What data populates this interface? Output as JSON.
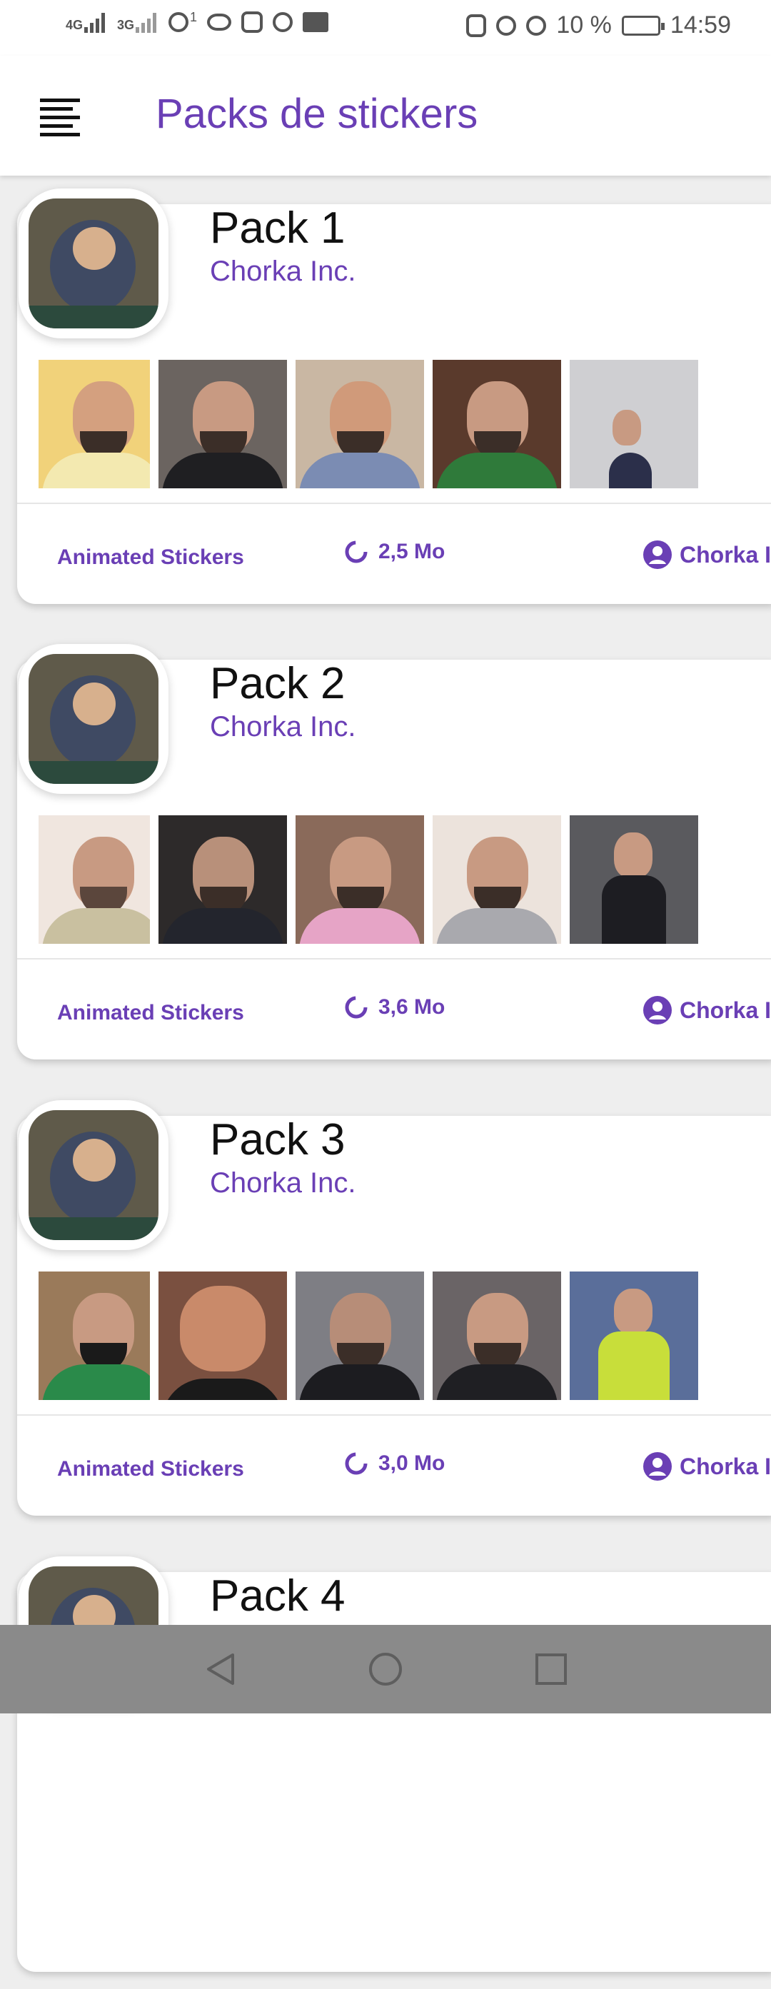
{
  "status_bar": {
    "net1": "4G",
    "net2": "3G",
    "hotspot_count": "1",
    "battery": "10 %",
    "time": "14:59"
  },
  "app_bar": {
    "title": "Packs de stickers",
    "menu_icon": "menu-icon"
  },
  "packs": [
    {
      "title": "Pack 1",
      "author": "Chorka Inc.",
      "type": "Animated Stickers",
      "size": "2,5 Mo",
      "publisher": "Chorka In"
    },
    {
      "title": "Pack 2",
      "author": "Chorka Inc.",
      "type": "Animated Stickers",
      "size": "3,6 Mo",
      "publisher": "Chorka In"
    },
    {
      "title": "Pack 3",
      "author": "Chorka Inc.",
      "type": "Animated Stickers",
      "size": "3,0 Mo",
      "publisher": "Chorka In"
    },
    {
      "title": "Pack 4"
    }
  ],
  "colors": {
    "accent": "#6a3fb5",
    "nav_bar": "#8a8a8a"
  }
}
